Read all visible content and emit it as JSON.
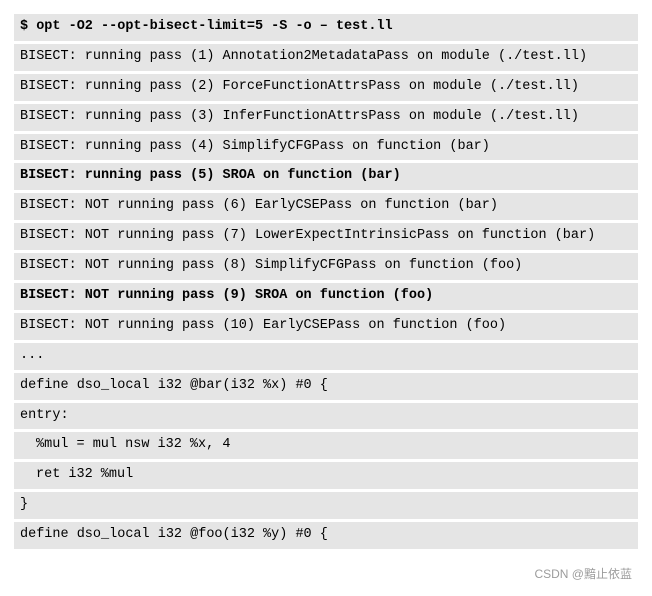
{
  "lines": [
    {
      "text": "$ opt -O2 --opt-bisect-limit=5 -S -o – test.ll",
      "bold": true,
      "indent": false
    },
    {
      "text": "BISECT: running pass (1) Annotation2MetadataPass on module (./test.ll)",
      "bold": false,
      "indent": false
    },
    {
      "text": "BISECT: running pass (2) ForceFunctionAttrsPass on module (./test.ll)",
      "bold": false,
      "indent": false
    },
    {
      "text": "BISECT: running pass (3) InferFunctionAttrsPass on module (./test.ll)",
      "bold": false,
      "indent": false
    },
    {
      "text": "BISECT: running pass (4) SimplifyCFGPass on function (bar)",
      "bold": false,
      "indent": false
    },
    {
      "text": "BISECT: running pass (5) SROA on function (bar)",
      "bold": true,
      "indent": false
    },
    {
      "text": "BISECT: NOT running pass (6) EarlyCSEPass on function (bar)",
      "bold": false,
      "indent": false
    },
    {
      "text": "BISECT: NOT running pass (7) LowerExpectIntrinsicPass on function (bar)",
      "bold": false,
      "indent": false
    },
    {
      "text": "BISECT: NOT running pass (8) SimplifyCFGPass on function (foo)",
      "bold": false,
      "indent": false
    },
    {
      "text": "BISECT: NOT running pass (9) SROA on function (foo)",
      "bold": true,
      "indent": false
    },
    {
      "text": "BISECT: NOT running pass (10) EarlyCSEPass on function (foo)",
      "bold": false,
      "indent": false
    },
    {
      "text": "...",
      "bold": false,
      "indent": false
    },
    {
      "text": "define dso_local i32 @bar(i32 %x) #0 {",
      "bold": false,
      "indent": false
    },
    {
      "text": "entry:",
      "bold": false,
      "indent": false
    },
    {
      "text": "%mul = mul nsw i32 %x, 4",
      "bold": false,
      "indent": true
    },
    {
      "text": "ret i32 %mul",
      "bold": false,
      "indent": true
    },
    {
      "text": "}",
      "bold": false,
      "indent": false
    },
    {
      "text": "define dso_local i32 @foo(i32 %y) #0 {",
      "bold": false,
      "indent": false
    }
  ],
  "watermark": "CSDN @黯止依蓝"
}
